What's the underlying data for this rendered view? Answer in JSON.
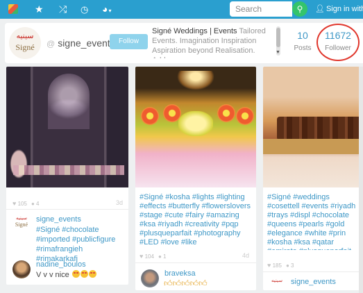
{
  "nav": {
    "icons": [
      "app-icon",
      "star-icon",
      "shuffle-icon",
      "clock-icon",
      "globe-icon"
    ],
    "search_placeholder": "Search",
    "search_icon": "search-icon",
    "signin_label": "Sign in with"
  },
  "profile": {
    "logo_arabic": "سينيه",
    "logo_latin": "Signé",
    "username": "signe_events",
    "follow_label": "Follow",
    "bio_name": "Signé Weddings | Events",
    "bio_text": " Tailored Events. Imagination Inspiration Aspiration beyond Realisation. Address",
    "posts_count": "10",
    "posts_label": "Posts",
    "followers_count": "11672",
    "followers_label": "Follower"
  },
  "cards": [
    {
      "likes": "105",
      "comments": "4",
      "age": "3d",
      "author": "signe_events",
      "caption": "#Signé #chocolate #imported #publicfigure #rimafrangieh #rimakarkafi",
      "comment_user": "nadine_boulos",
      "comment_text": "V v v nice"
    },
    {
      "tags": "#Signé #kosha #lights #lighting #effects #butterfly #flowerslovers #stage #cute #fairy #amazing #ksa #riyadh #creativity #pqp #plusqueparfait #photography #LED #love #like",
      "likes": "104",
      "comments": "1",
      "age": "4d",
      "comment_user": "braveksa"
    },
    {
      "tags": "#Signé #weddings #cosettell #events #riyadh #trays #displ #chocolate #queens #pearls #gold #elegance #white #prin #kosha #ksa #qatar #emirate #plusqueparfait #inlove #ama #designs #art #creativity",
      "likes": "185",
      "comments": "3",
      "author": "signe_events"
    }
  ],
  "colors": {
    "nav": "#2a9fcf",
    "link": "#3d97c6",
    "follow": "#8fd3ec",
    "search_button": "#34c46b",
    "highlight": "#e0362c"
  }
}
